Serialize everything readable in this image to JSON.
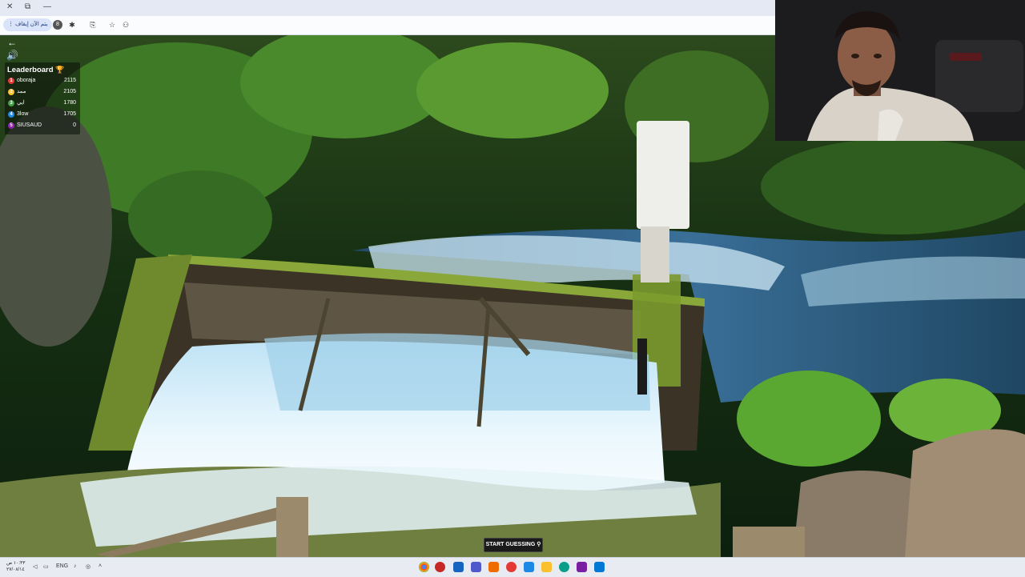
{
  "browser": {
    "profile_chip": "يتم الآن إيقاف"
  },
  "overlay": {
    "leaderboard_title": "Leaderboard",
    "players": [
      {
        "rank": "1",
        "name": "oboraja",
        "score": "2115",
        "color": "#e53935"
      },
      {
        "rank": "2",
        "name": "ممد",
        "score": "2105",
        "color": "#fbc02d"
      },
      {
        "rank": "3",
        "name": "ايي",
        "score": "1780",
        "color": "#43a047"
      },
      {
        "rank": "4",
        "name": "3low",
        "score": "1705",
        "color": "#1e88e5"
      },
      {
        "rank": "5",
        "name": "SIUSAUD",
        "score": "0",
        "color": "#8e24aa"
      }
    ]
  },
  "game": {
    "start_guessing_label": "START GUESSING"
  },
  "taskbar": {
    "clock_time": "١٠:٣٣ ص",
    "clock_date": "٢٧/٠٨/١٤",
    "language": "ENG"
  }
}
